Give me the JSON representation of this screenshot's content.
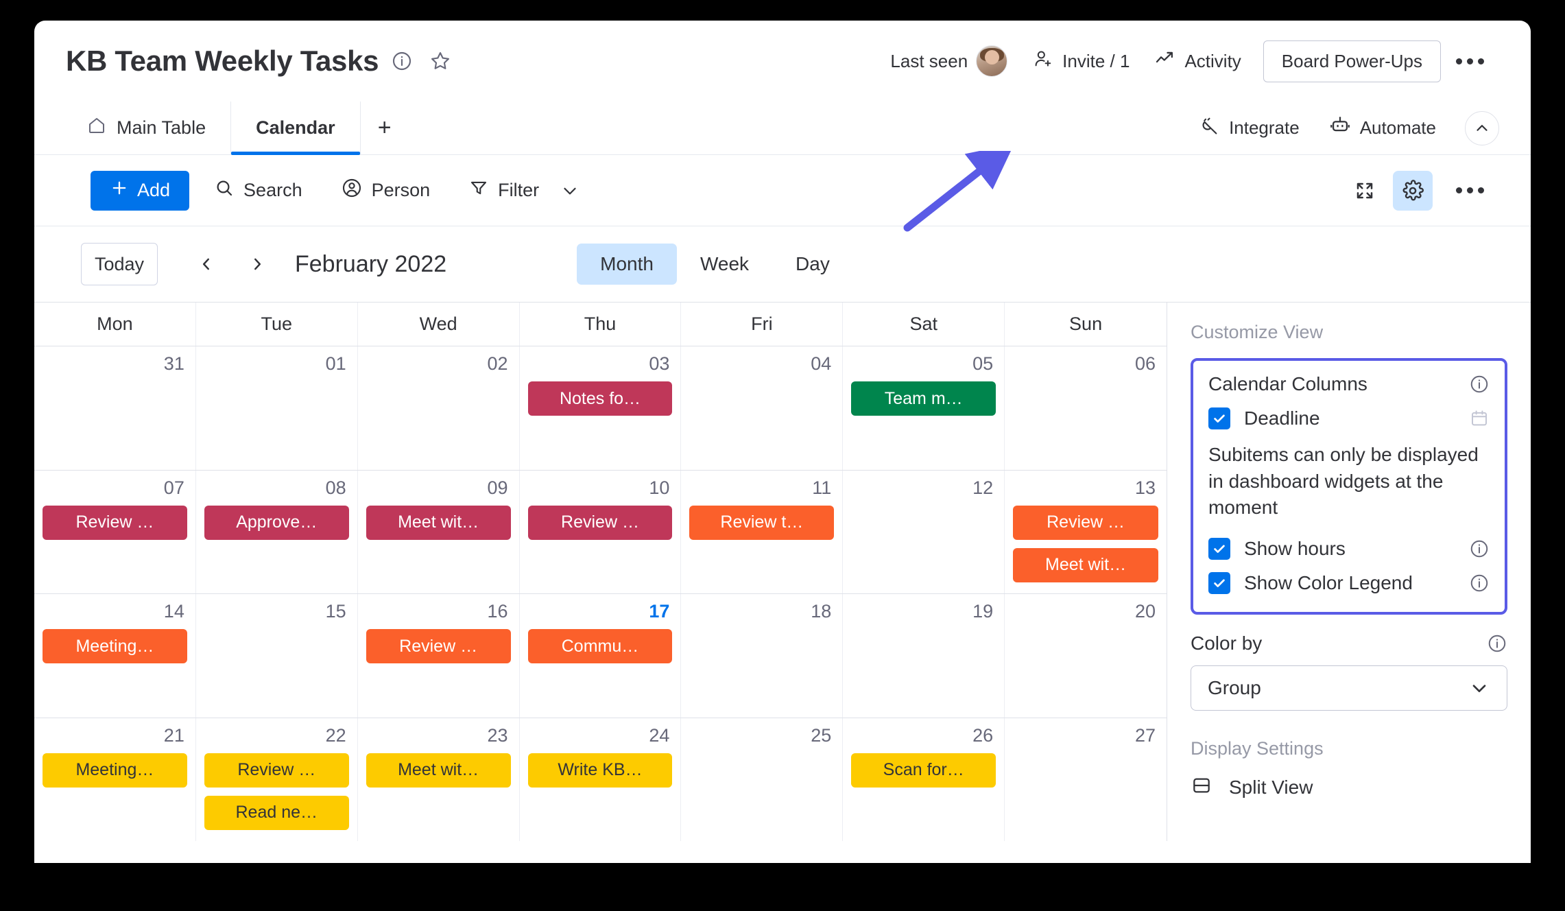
{
  "header": {
    "board_title": "KB Team Weekly Tasks",
    "info_icon": "info-circle-icon",
    "favorite_icon": "star-icon",
    "last_seen_label": "Last seen",
    "invite_label": "Invite / 1",
    "activity_label": "Activity",
    "power_ups_label": "Board Power-Ups",
    "more_icon": "more-horizontal-icon"
  },
  "tabs": {
    "items": [
      {
        "label": "Main Table",
        "icon": "home-icon",
        "active": false
      },
      {
        "label": "Calendar",
        "icon": "",
        "active": true
      }
    ],
    "add_label": "+",
    "integrate_label": "Integrate",
    "automate_label": "Automate",
    "collapse_icon": "chevron-up-icon"
  },
  "toolbar": {
    "add_label": "Add",
    "search_label": "Search",
    "person_label": "Person",
    "filter_label": "Filter",
    "expand_icon": "fullscreen-icon",
    "settings_icon": "gear-icon",
    "more_icon": "more-horizontal-icon"
  },
  "calendar_nav": {
    "today_label": "Today",
    "prev_icon": "chevron-left-icon",
    "next_icon": "chevron-right-icon",
    "month_label": "February 2022",
    "views": [
      {
        "label": "Month",
        "active": true
      },
      {
        "label": "Week",
        "active": false
      },
      {
        "label": "Day",
        "active": false
      }
    ]
  },
  "calendar": {
    "day_headers": [
      "Mon",
      "Tue",
      "Wed",
      "Thu",
      "Fri",
      "Sat",
      "Sun"
    ],
    "colors": {
      "crimson": "#bf3759",
      "green": "#00854d",
      "orange": "#fb602b",
      "yellow": "#fdcb00",
      "today_blue": "#0073ea"
    },
    "weeks": [
      [
        {
          "date": "31",
          "today": false,
          "events": []
        },
        {
          "date": "01",
          "today": false,
          "events": []
        },
        {
          "date": "02",
          "today": false,
          "events": []
        },
        {
          "date": "03",
          "today": false,
          "events": [
            {
              "label": "Notes fo…",
              "color": "#bf3759",
              "dark_text": false
            }
          ]
        },
        {
          "date": "04",
          "today": false,
          "events": []
        },
        {
          "date": "05",
          "today": false,
          "events": [
            {
              "label": "Team m…",
              "color": "#00854d",
              "dark_text": false
            }
          ]
        },
        {
          "date": "06",
          "today": false,
          "events": []
        }
      ],
      [
        {
          "date": "07",
          "today": false,
          "events": [
            {
              "label": "Review …",
              "color": "#bf3759",
              "dark_text": false
            }
          ]
        },
        {
          "date": "08",
          "today": false,
          "events": [
            {
              "label": "Approve…",
              "color": "#bf3759",
              "dark_text": false
            }
          ]
        },
        {
          "date": "09",
          "today": false,
          "events": [
            {
              "label": "Meet wit…",
              "color": "#bf3759",
              "dark_text": false
            }
          ]
        },
        {
          "date": "10",
          "today": false,
          "events": [
            {
              "label": "Review …",
              "color": "#bf3759",
              "dark_text": false
            }
          ]
        },
        {
          "date": "11",
          "today": false,
          "events": [
            {
              "label": "Review t…",
              "color": "#fb602b",
              "dark_text": false
            }
          ]
        },
        {
          "date": "12",
          "today": false,
          "events": []
        },
        {
          "date": "13",
          "today": false,
          "events": [
            {
              "label": "Review …",
              "color": "#fb602b",
              "dark_text": false
            },
            {
              "label": "Meet wit…",
              "color": "#fb602b",
              "dark_text": false
            }
          ]
        }
      ],
      [
        {
          "date": "14",
          "today": false,
          "events": [
            {
              "label": "Meeting…",
              "color": "#fb602b",
              "dark_text": false
            }
          ]
        },
        {
          "date": "15",
          "today": false,
          "events": []
        },
        {
          "date": "16",
          "today": false,
          "events": [
            {
              "label": "Review …",
              "color": "#fb602b",
              "dark_text": false
            }
          ]
        },
        {
          "date": "17",
          "today": true,
          "events": [
            {
              "label": "Commu…",
              "color": "#fb602b",
              "dark_text": false
            }
          ]
        },
        {
          "date": "18",
          "today": false,
          "events": []
        },
        {
          "date": "19",
          "today": false,
          "events": []
        },
        {
          "date": "20",
          "today": false,
          "events": []
        }
      ],
      [
        {
          "date": "21",
          "today": false,
          "events": [
            {
              "label": "Meeting…",
              "color": "#fdcb00",
              "dark_text": true
            }
          ]
        },
        {
          "date": "22",
          "today": false,
          "events": [
            {
              "label": "Review …",
              "color": "#fdcb00",
              "dark_text": true
            },
            {
              "label": "Read ne…",
              "color": "#fdcb00",
              "dark_text": true
            }
          ]
        },
        {
          "date": "23",
          "today": false,
          "events": [
            {
              "label": "Meet wit…",
              "color": "#fdcb00",
              "dark_text": true
            }
          ]
        },
        {
          "date": "24",
          "today": false,
          "events": [
            {
              "label": "Write KB…",
              "color": "#fdcb00",
              "dark_text": true
            }
          ]
        },
        {
          "date": "25",
          "today": false,
          "events": []
        },
        {
          "date": "26",
          "today": false,
          "events": [
            {
              "label": "Scan for…",
              "color": "#fdcb00",
              "dark_text": true
            }
          ]
        },
        {
          "date": "27",
          "today": false,
          "events": []
        }
      ]
    ]
  },
  "panel": {
    "title": "Customize View",
    "calendar_columns_label": "Calendar Columns",
    "deadline_label": "Deadline",
    "deadline_checked": true,
    "deadline_icon": "calendar-icon",
    "subitems_note": "Subitems can only be displayed in dashboard widgets at the moment",
    "show_hours_label": "Show hours",
    "show_hours_checked": true,
    "show_color_legend_label": "Show Color Legend",
    "show_color_legend_checked": true,
    "color_by_label": "Color by",
    "color_by_value": "Group",
    "display_settings_label": "Display Settings",
    "split_view_label": "Split View",
    "split_view_icon": "split-view-icon",
    "info_icon": "info-circle-icon",
    "highlight_color": "#5a5be6"
  },
  "annotation": {
    "arrow_color": "#5a5be6",
    "points_to": "gear-icon"
  }
}
